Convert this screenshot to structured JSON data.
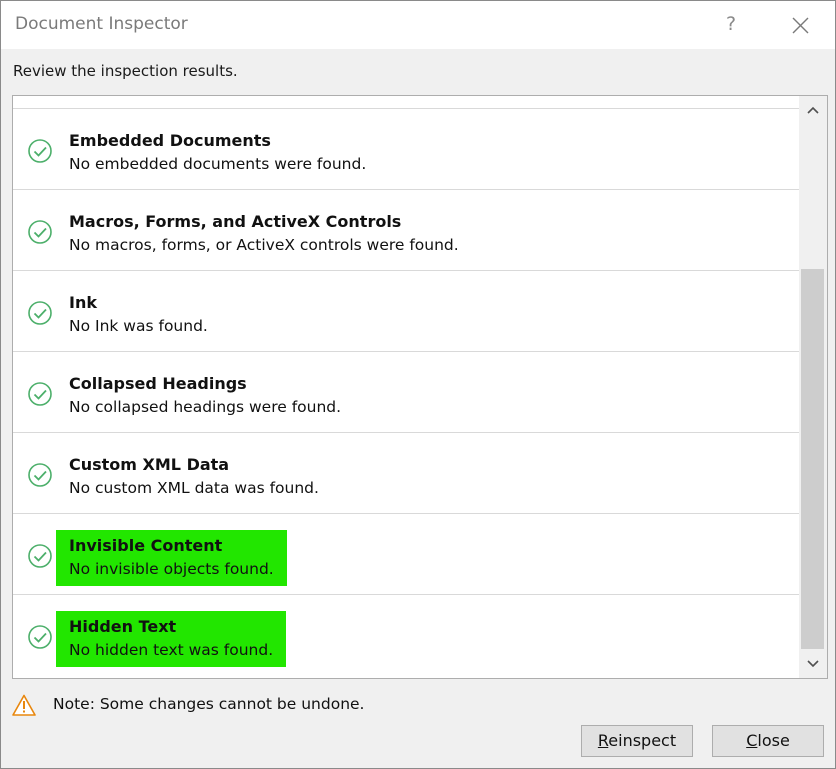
{
  "window": {
    "title": "Document Inspector",
    "help_glyph": "?"
  },
  "subtitle": "Review the inspection results.",
  "results": [
    {
      "title": "Embedded Documents",
      "description": "No embedded documents were found.",
      "highlighted": false
    },
    {
      "title": "Macros, Forms, and ActiveX Controls",
      "description": "No macros, forms, or ActiveX controls were found.",
      "highlighted": false
    },
    {
      "title": "Ink",
      "description": "No Ink was found.",
      "highlighted": false
    },
    {
      "title": "Collapsed Headings",
      "description": "No collapsed headings were found.",
      "highlighted": false
    },
    {
      "title": "Custom XML Data",
      "description": "No custom XML data was found.",
      "highlighted": false
    },
    {
      "title": "Invisible Content",
      "description": "No invisible objects found.",
      "highlighted": true
    },
    {
      "title": "Hidden Text",
      "description": "No hidden text was found.",
      "highlighted": true
    }
  ],
  "note": "Note: Some changes cannot be undone.",
  "buttons": {
    "reinspect": {
      "mnemonic": "R",
      "rest": "einspect"
    },
    "close": {
      "mnemonic": "C",
      "rest": "lose"
    }
  },
  "icons": {
    "result_status": "check-circle-icon",
    "note": "warning-triangle-icon"
  },
  "colors": {
    "check_green": "#4caf6a",
    "highlight": "#22e600",
    "warning_orange": "#e8870e"
  }
}
